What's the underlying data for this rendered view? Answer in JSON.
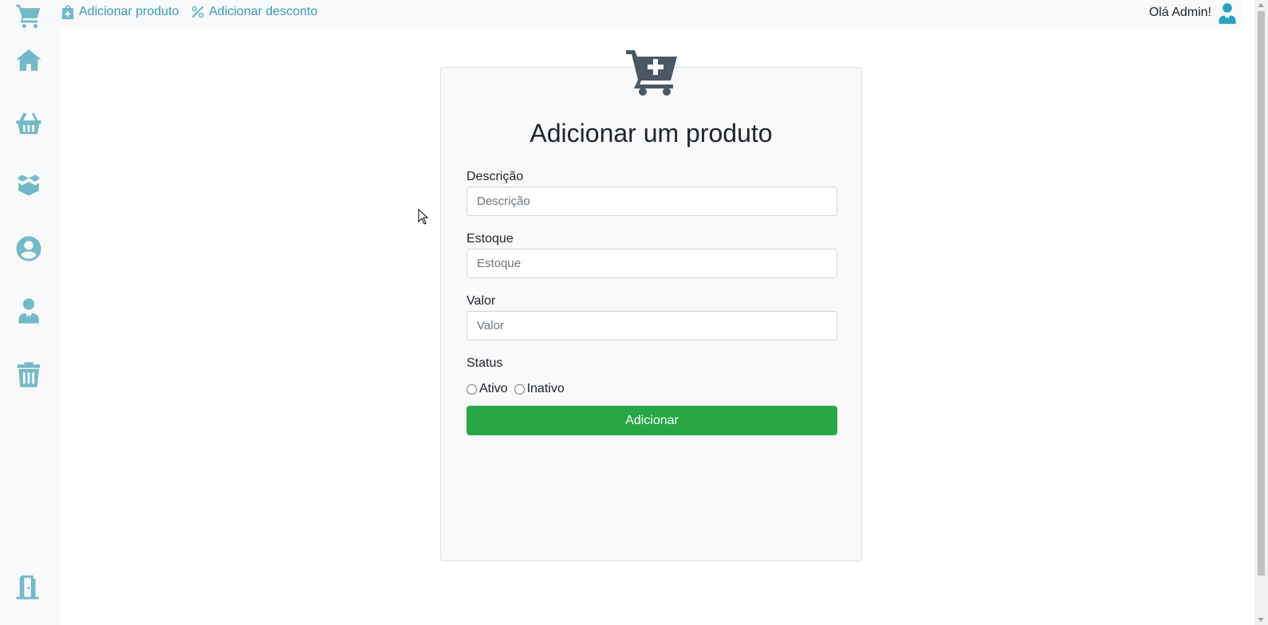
{
  "topbar": {
    "add_product": "Adicionar produto",
    "add_discount": "Adicionar desconto",
    "greeting": "Olá Admin!"
  },
  "sidebar": {
    "items": [
      {
        "icon": "cart-icon"
      },
      {
        "icon": "home-icon"
      },
      {
        "icon": "basket-icon"
      },
      {
        "icon": "box-icon"
      },
      {
        "icon": "user-circle-icon"
      },
      {
        "icon": "user-tie-icon"
      },
      {
        "icon": "trash-icon"
      },
      {
        "icon": "door-exit-icon"
      }
    ]
  },
  "form": {
    "title": "Adicionar um produto",
    "fields": [
      {
        "label": "Descrição",
        "placeholder": "Descrição",
        "value": ""
      },
      {
        "label": "Estoque",
        "placeholder": "Estoque",
        "value": ""
      },
      {
        "label": "Valor",
        "placeholder": "Valor",
        "value": ""
      }
    ],
    "status_label": "Status",
    "status_options": [
      "Ativo",
      "Inativo"
    ],
    "submit_label": "Adicionar"
  },
  "colors": {
    "icon": "#74b9c8",
    "link": "#3c9bb5",
    "submit": "#28a745",
    "hero_icon": "#4a5866"
  }
}
